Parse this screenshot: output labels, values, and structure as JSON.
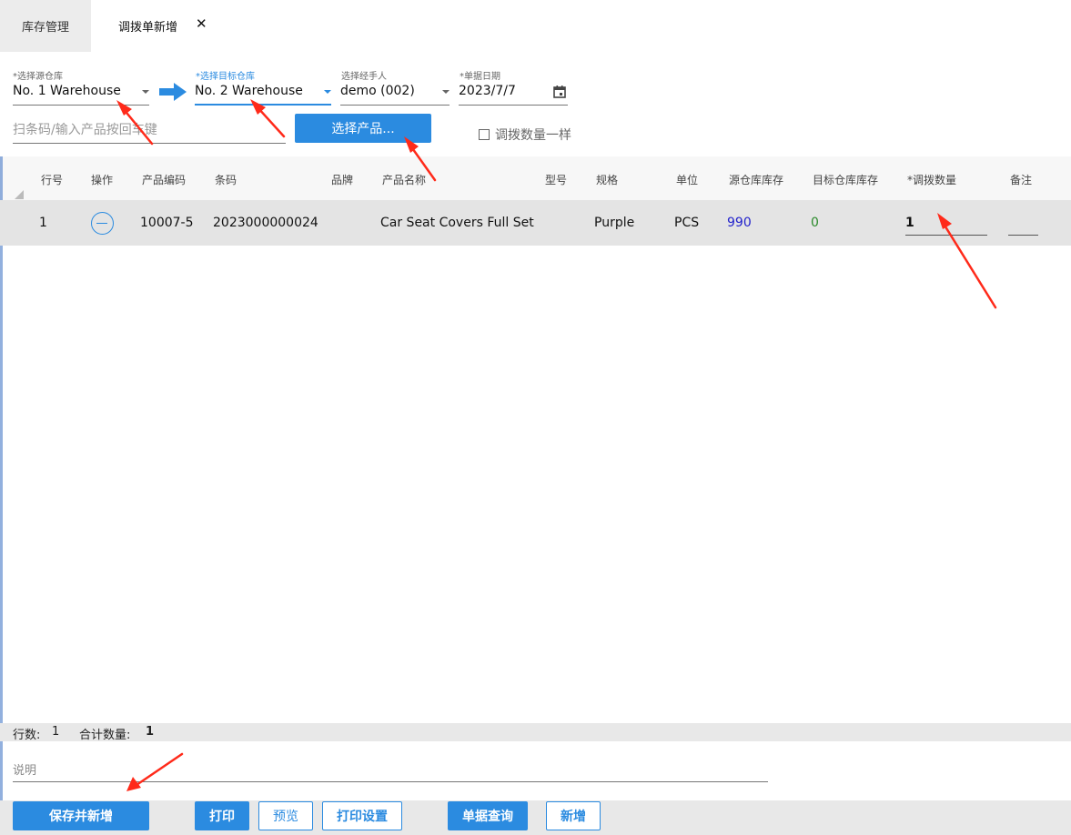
{
  "tabs": {
    "inventory": "库存管理",
    "active": "调拨单新增",
    "close": "✕"
  },
  "form": {
    "source_label": "*选择源仓库",
    "source_value": "No. 1 Warehouse",
    "target_label": "*选择目标仓库",
    "target_value": "No. 2 Warehouse",
    "handler_label": "选择经手人",
    "handler_value": "demo (002)",
    "date_label": "*单据日期",
    "date_value": "2023/7/7",
    "scan_placeholder": "扫条码/输入产品按回车键",
    "select_product": "选择产品...",
    "same_qty": "调拨数量一样"
  },
  "table": {
    "headers": {
      "line": "行号",
      "action": "操作",
      "code": "产品编码",
      "barcode": "条码",
      "brand": "品牌",
      "name": "产品名称",
      "model": "型号",
      "spec": "规格",
      "unit": "单位",
      "source_stock": "源仓库库存",
      "target_stock": "目标仓库库存",
      "qty": "*调拨数量",
      "note": "备注"
    },
    "rows": [
      {
        "line": "1",
        "code": "10007-5",
        "barcode": "2023000000024",
        "brand": "",
        "name": "Car Seat Covers Full Set",
        "model": "",
        "spec": "Purple",
        "unit": "PCS",
        "source_stock": "990",
        "target_stock": "0",
        "qty": "1",
        "note": ""
      }
    ]
  },
  "summary": {
    "rows_label": "行数:",
    "rows_value": "1",
    "total_label": "合计数量:",
    "total_value": "1"
  },
  "description_placeholder": "说明",
  "buttons": {
    "save_new": "保存并新增",
    "print": "打印",
    "preview": "预览",
    "print_settings": "打印设置",
    "query": "单据查询",
    "add": "新增"
  },
  "colors": {
    "accent": "#2b8be0",
    "annotation_arrow": "#ff2a1a",
    "source_stock": "#2222cc",
    "target_stock": "#2a8a2a"
  }
}
